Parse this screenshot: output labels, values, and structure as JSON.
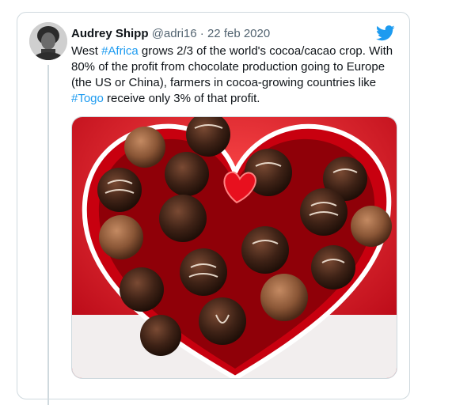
{
  "tweet": {
    "author_name": "Audrey Shipp",
    "handle": "@adri16",
    "separator": "·",
    "date": "22 feb 2020",
    "text": {
      "part1": "West ",
      "hashtag1": "#Africa",
      "part2": " grows 2/3 of the world's cocoa/cacao crop. With 80% of the profit from chocolate production going to Europe (the US or China), farmers in cocoa-growing countries like ",
      "hashtag2": "#Togo",
      "part3": " receive only 3% of that profit."
    },
    "avatar_icon": "user-avatar-photo",
    "bird_icon": "twitter-bird-icon",
    "media_icon": "heart-chocolate-box-photo"
  },
  "colors": {
    "accent": "#1d9bf0",
    "text": "#0f1419",
    "muted": "#536471",
    "border": "#cfd9de"
  }
}
